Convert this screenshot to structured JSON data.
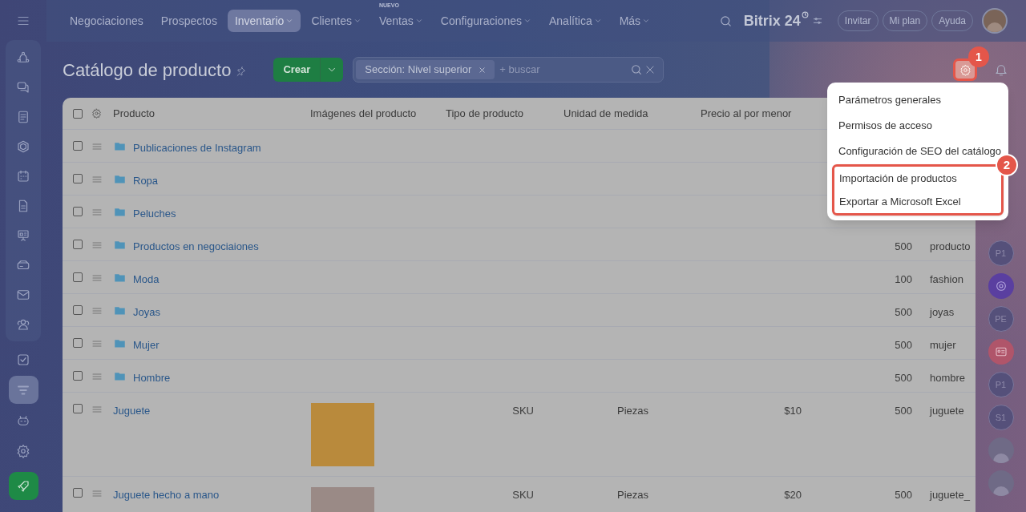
{
  "top_nav": {
    "items": [
      {
        "label": "Negociaciones",
        "selected": false,
        "dropdown": false
      },
      {
        "label": "Prospectos",
        "selected": false,
        "dropdown": false
      },
      {
        "label": "Inventario",
        "selected": true,
        "dropdown": true
      },
      {
        "label": "Clientes",
        "selected": false,
        "dropdown": true
      },
      {
        "label": "Ventas",
        "selected": false,
        "dropdown": true,
        "badge": "NUEVO"
      },
      {
        "label": "Configuraciones",
        "selected": false,
        "dropdown": true
      },
      {
        "label": "Analítica",
        "selected": false,
        "dropdown": true
      },
      {
        "label": "Más",
        "selected": false,
        "dropdown": true
      }
    ],
    "logo": "Bitrix 24",
    "buttons": [
      "Invitar",
      "Mi plan",
      "Ayuda"
    ]
  },
  "sidebar": {
    "items": [
      {
        "selected": false
      },
      {
        "selected": false
      },
      {
        "selected": false
      },
      {
        "selected": false
      },
      {
        "selected": false
      },
      {
        "selected": false
      },
      {
        "selected": false
      },
      {
        "selected": false
      },
      {
        "selected": false
      },
      {
        "selected": false
      },
      {
        "selected": false
      },
      {
        "selected": true
      },
      {
        "selected": false
      },
      {
        "selected": false
      },
      {
        "selected": false
      }
    ]
  },
  "page": {
    "title": "Catálogo de producto",
    "create_button": "Crear",
    "filter": {
      "chip": "Sección: Nivel superior",
      "placeholder": "+ buscar"
    }
  },
  "settings_button": {
    "highlighted": true,
    "callout": "1"
  },
  "settings_menu": {
    "callout": "2",
    "items": [
      {
        "label": "Parámetros generales",
        "highlighted": false
      },
      {
        "label": "Permisos de acceso",
        "highlighted": false
      },
      {
        "label": "Configuración de SEO del catálogo",
        "highlighted": false
      },
      {
        "label": "Importación de productos",
        "highlighted": true
      },
      {
        "label": "Exportar a Microsoft Excel",
        "highlighted": true
      }
    ]
  },
  "table": {
    "select_all_checked": false,
    "columns": [
      "Producto",
      "Imágenes del producto",
      "Tipo de producto",
      "Unidad de medida",
      "Precio al por menor"
    ],
    "rows": [
      {
        "kind": "folder",
        "name": "Publicaciones de Instagram",
        "checked": false
      },
      {
        "kind": "folder",
        "name": "Ropa",
        "checked": false
      },
      {
        "kind": "folder",
        "name": "Peluches",
        "checked": false
      },
      {
        "kind": "folder",
        "name": "Productos en negociaiones",
        "checked": false,
        "column_7": "500",
        "column_8": "producto"
      },
      {
        "kind": "folder",
        "name": "Moda",
        "checked": false,
        "column_7": "100",
        "column_8": "fashion"
      },
      {
        "kind": "folder",
        "name": "Joyas",
        "checked": false,
        "column_7": "500",
        "column_8": "joyas"
      },
      {
        "kind": "folder",
        "name": "Mujer",
        "checked": false,
        "column_7": "500",
        "column_8": "mujer"
      },
      {
        "kind": "folder",
        "name": "Hombre",
        "checked": false,
        "column_7": "500",
        "column_8": "hombre"
      },
      {
        "kind": "product",
        "name": "Juguete",
        "checked": false,
        "type": "SKU",
        "unit": "Piezas",
        "price": "$10",
        "column_7": "500",
        "column_8": "juguete"
      },
      {
        "kind": "product",
        "name": "Juguete hecho a mano",
        "checked": false,
        "type": "SKU",
        "unit": "Piezas",
        "price": "$20",
        "column_7": "500",
        "column_8": "juguete_"
      }
    ]
  },
  "right_rail": [
    {
      "kind": "initials",
      "text": "P1"
    },
    {
      "kind": "logo"
    },
    {
      "kind": "initials",
      "text": "PE"
    },
    {
      "kind": "card"
    },
    {
      "kind": "initials",
      "text": "P1"
    },
    {
      "kind": "initials",
      "text": "S1"
    },
    {
      "kind": "avatar"
    },
    {
      "kind": "avatar"
    }
  ]
}
